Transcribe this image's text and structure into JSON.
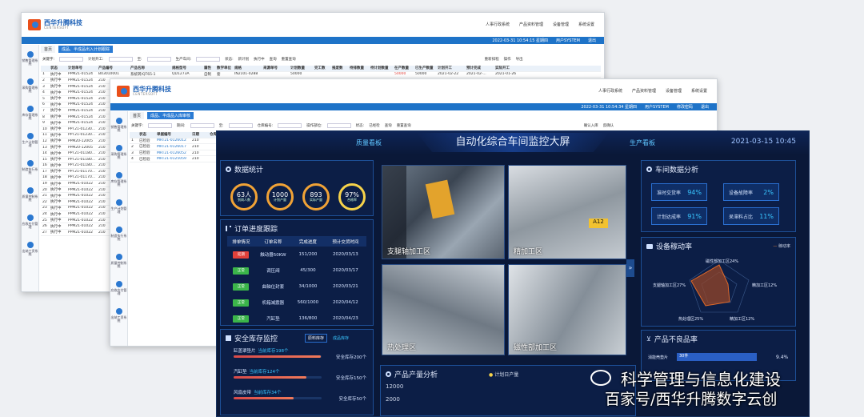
{
  "back_window": {
    "brand_cn": "西华升腾科技",
    "brand_en": "CENTERSOFT",
    "nav": [
      "人事行政系统",
      "产品资料管理",
      "设备管理",
      "系统设置"
    ],
    "bar_date": "2022-03-31 10:54:15 星期四",
    "bar_user": "用户SYSTEM",
    "bar_exit": "退出",
    "tab_home": "首页",
    "tab_active": "成品、半成品出入计划跟踪",
    "sidebar": [
      "销售管理系统",
      "采购管理系统",
      "库存管理系统",
      "生产计划管理",
      "制造执行系统",
      "质量控制系统",
      "应收应付管理",
      "出纳工资系统"
    ],
    "filter": {
      "keyword": "关键字:",
      "plan_start": "计划开工:",
      "to": "至:",
      "workshop": "生产车间:",
      "status": "状态:",
      "status_val": "新计划",
      "run_btn": "执行中",
      "query": "查询",
      "reset": "重置查询",
      "reschedule": "重新排程",
      "ops": "操作",
      "export": "导出"
    },
    "columns": [
      "",
      "状态",
      "计划单号",
      "产品编号",
      "产品名称",
      "规格型号",
      "属性",
      "数学单位",
      "规格",
      "来源单号",
      "计划数量",
      "完工数",
      "报废数",
      "待排数量",
      "待计划数量",
      "在产数量",
      "已生产数量",
      "计划开工",
      "预计完成",
      "实际开工"
    ],
    "rows": [
      {
        "n": "1",
        "status": "执行中",
        "plan": "PPM21-01524",
        "code": "B03010001",
        "name": "系统转/QT65-1",
        "spec": "QD1273A",
        "attr": "自制",
        "unit": "套",
        "std": "IN2101-0288",
        "qty": "50000",
        "q2": "50000",
        "q3": "50000",
        "d1": "2021-02-22",
        "d2": "2021-02-...",
        "d3": "2021-01-26"
      },
      {
        "n": "2",
        "status": "执行中",
        "plan": "PPM21-01524",
        "code": "210"
      },
      {
        "n": "3",
        "status": "执行中",
        "plan": "PPM21-01524",
        "code": "210"
      },
      {
        "n": "4",
        "status": "执行中",
        "plan": "PPM21-01524",
        "code": "210"
      },
      {
        "n": "5",
        "status": "执行中",
        "plan": "PPM21-01524",
        "code": "210"
      },
      {
        "n": "6",
        "status": "执行中",
        "plan": "PPM21-01524",
        "code": "210"
      },
      {
        "n": "7",
        "status": "执行中",
        "plan": "PPM21-01524",
        "code": "210"
      },
      {
        "n": "8",
        "status": "执行中",
        "plan": "PPM21-01524",
        "code": "210"
      },
      {
        "n": "9",
        "status": "执行中",
        "plan": "PPM21-01524",
        "code": "210"
      },
      {
        "n": "10",
        "status": "执行中",
        "plan": "PPT21-01230...",
        "code": "210"
      },
      {
        "n": "11",
        "status": "执行中",
        "plan": "PPT21-01230...",
        "code": "210"
      },
      {
        "n": "12",
        "status": "执行中",
        "plan": "PPM20-12005",
        "code": "210"
      },
      {
        "n": "13",
        "status": "执行中",
        "plan": "PPM20-12005",
        "code": "210"
      },
      {
        "n": "14",
        "status": "执行中",
        "plan": "PPT21-01180...",
        "code": "210"
      },
      {
        "n": "15",
        "status": "执行中",
        "plan": "PPT21-01180...",
        "code": "210"
      },
      {
        "n": "16",
        "status": "执行中",
        "plan": "PPT21-01180...",
        "code": "210"
      },
      {
        "n": "17",
        "status": "执行中",
        "plan": "PPT21-01170...",
        "code": "210"
      },
      {
        "n": "18",
        "status": "执行中",
        "plan": "PPT21-01170...",
        "code": "210"
      },
      {
        "n": "19",
        "status": "执行中",
        "plan": "PPM21-01022",
        "code": "210"
      },
      {
        "n": "20",
        "status": "执行中",
        "plan": "PPM21-01022",
        "code": "210"
      },
      {
        "n": "21",
        "status": "执行中",
        "plan": "PPM21-01022",
        "code": "210"
      },
      {
        "n": "22",
        "status": "执行中",
        "plan": "PPM21-01022",
        "code": "210"
      },
      {
        "n": "23",
        "status": "执行中",
        "plan": "PPM21-01022",
        "code": "210"
      },
      {
        "n": "24",
        "status": "执行中",
        "plan": "PPM21-01022",
        "code": "210"
      },
      {
        "n": "25",
        "status": "执行中",
        "plan": "PPM21-01022",
        "code": "210"
      },
      {
        "n": "26",
        "status": "执行中",
        "plan": "PPM21-01022",
        "code": "210"
      },
      {
        "n": "27",
        "status": "执行中",
        "plan": "PPM21-01022",
        "code": "210"
      }
    ]
  },
  "mid_window": {
    "brand_cn": "西华升腾科技",
    "brand_en": "CENTERSOFT",
    "nav": [
      "人事行政系统",
      "产品资料管理",
      "设备管理",
      "系统设置"
    ],
    "bar_date": "2022-03-31 10:54:34 星期四",
    "bar_user": "用户SYSTEM",
    "bar_pwd": "修改密码",
    "bar_exit": "退出",
    "tab_home": "首页",
    "tab_active": "成品、半成品入库审核",
    "sidebar": [
      "销售管理系统",
      "采购管理系统",
      "库存管理系统",
      "生产计划管理",
      "制造执行系统",
      "质量控制系统",
      "应收应付管理",
      "出纳工资系统"
    ],
    "filter": {
      "keyword": "关键字:",
      "date": "期间:",
      "to": "至:",
      "warehouse": "仓库编号:",
      "dept": "部位:",
      "ops": "操作部位:",
      "status": "状态:",
      "status_val": "已经检",
      "query": "查询",
      "reset": "重置查询",
      "confirm": "确认入库",
      "back": "反确认"
    },
    "columns": [
      "",
      "状态",
      "单据编号",
      "日期",
      "仓库编号",
      "部门",
      "制单人",
      "审核人",
      "交货车间",
      "相关编号",
      "规格",
      "单位",
      "数量",
      "单价",
      "金额",
      "批号",
      "操作员",
      "备注"
    ],
    "rows": [
      {
        "n": "1",
        "status": "已检验",
        "doc": "MRT21-0126012",
        "date": "210"
      },
      {
        "n": "2",
        "status": "已检验",
        "doc": "MRT21-0126017",
        "date": "210"
      },
      {
        "n": "3",
        "status": "已检验",
        "doc": "MRT21-0126052",
        "date": "210"
      },
      {
        "n": "4",
        "status": "已检验",
        "doc": "MRT21-0125059",
        "date": "210"
      }
    ]
  },
  "dashboard": {
    "title": "自动化综合车间监控大屏",
    "tab_left": "质量看板",
    "tab_right": "生产看板",
    "datetime": "2021-03-15 10:45",
    "stats": {
      "title": "数据统计",
      "items": [
        {
          "value": "63人",
          "label": "到岗人数"
        },
        {
          "value": "1000",
          "label": "计划产量"
        },
        {
          "value": "893",
          "label": "实际产量"
        },
        {
          "value": "97%",
          "label": "合格率"
        }
      ]
    },
    "orders": {
      "title": "订单进度跟踪",
      "columns": [
        "排单情况",
        "订单名称",
        "完成进度",
        "预计交货时间"
      ],
      "rows": [
        {
          "status": "延期",
          "status_color": "#e2413a",
          "name": "触动器50KW",
          "progress": "151/200",
          "date": "2020/03/13"
        },
        {
          "status": "正常",
          "status_color": "#3bb54a",
          "name": "调压阀",
          "progress": "45/300",
          "date": "2020/03/17"
        },
        {
          "status": "正常",
          "status_color": "#3bb54a",
          "name": "曲轴位封套",
          "progress": "34/1000",
          "date": "2020/03/21"
        },
        {
          "status": "正常",
          "status_color": "#3bb54a",
          "name": "机箱减震器",
          "progress": "560/1000",
          "date": "2020/04/12"
        },
        {
          "status": "正常",
          "status_color": "#3bb54a",
          "name": "汽缸垫",
          "progress": "136/800",
          "date": "2020/04/23"
        }
      ]
    },
    "stock": {
      "title": "安全库存监控",
      "tab_raw": "原料库存",
      "tab_done": "成品库存",
      "items": [
        {
          "name": "缸盖罩垫片",
          "current": "当前库存198个",
          "safe": "安全库存200个",
          "level": 0.99
        },
        {
          "name": "汽缸垫",
          "current": "当前库存124个",
          "safe": "安全库存150个",
          "level": 0.83
        },
        {
          "name": "风扇皮带",
          "current": "当前库存34个",
          "safe": "安全库存50个",
          "level": 0.68
        }
      ]
    },
    "cameras": [
      "支腿轴加工区",
      "精加工区",
      "热处理区",
      "磁性部加工区"
    ],
    "production": {
      "title": "产品产量分析",
      "legend_a": "计划日产量",
      "legend_b": "",
      "ticks": [
        "12000",
        "2000"
      ]
    },
    "workshop": {
      "title": "车间数据分析",
      "kpis": [
        {
          "label": "准时交货率",
          "value": "94%"
        },
        {
          "label": "设备故障率",
          "value": "2%"
        },
        {
          "label": "计划达成率",
          "value": "91%"
        },
        {
          "label": "呆滞料占比",
          "value": "11%"
        }
      ]
    },
    "equipment": {
      "title": "设备稼动率",
      "legend": "稼动率",
      "labels": [
        "磁性部加工区24%",
        "精加工区12%",
        "精加工区12%",
        "热处理区25%",
        "支腿轴加工区27%"
      ]
    },
    "defect": {
      "title": "产品不良品率",
      "label": "消能壳垫片",
      "bar_value": "30件",
      "rate": "9.4%"
    }
  },
  "watermark": {
    "line1": "科学管理与信息化建设",
    "line2": "百家号/西华升腾数字云创"
  }
}
